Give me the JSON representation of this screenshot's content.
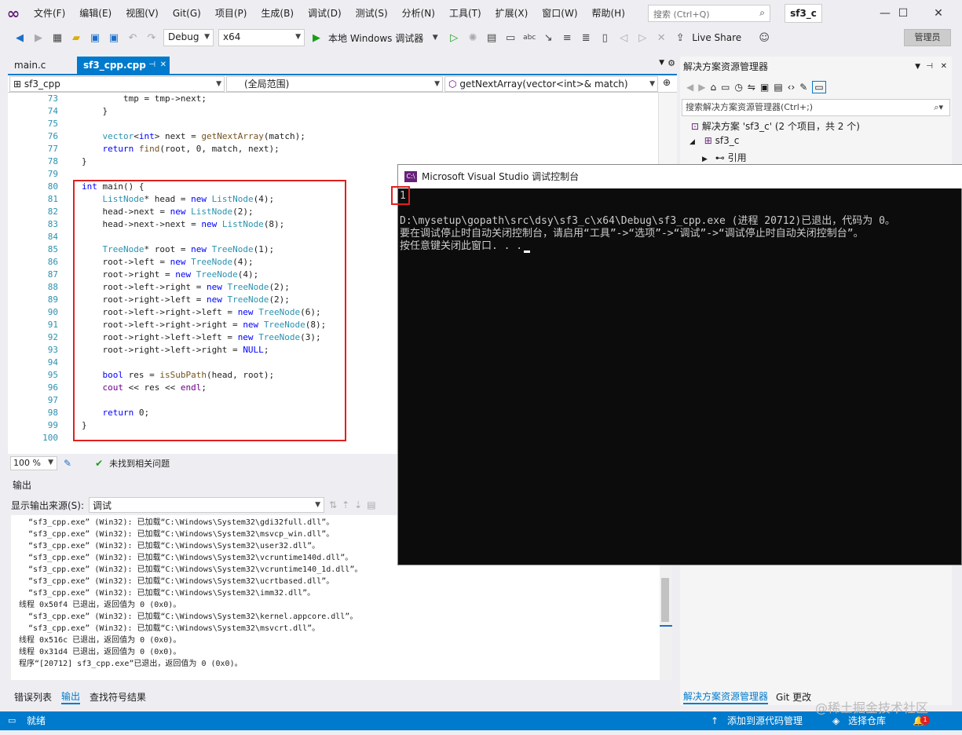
{
  "menu": {
    "items": [
      "文件(F)",
      "编辑(E)",
      "视图(V)",
      "Git(G)",
      "项目(P)",
      "生成(B)",
      "调试(D)",
      "测试(S)",
      "分析(N)",
      "工具(T)",
      "扩展(X)",
      "窗口(W)",
      "帮助(H)"
    ],
    "search_placeholder": "搜索 (Ctrl+Q)",
    "solution_name": "sf3_c"
  },
  "toolbar": {
    "config": "Debug",
    "platform": "x64",
    "run_label": "本地 Windows 调试器",
    "live_share": "Live Share",
    "admin": "管理员"
  },
  "tabs": [
    {
      "label": "main.c",
      "active": false
    },
    {
      "label": "sf3_cpp.cpp",
      "active": true
    }
  ],
  "navbar": {
    "project": "sf3_cpp",
    "scope": "(全局范围)",
    "member": "getNextArray(vector<int>& match)"
  },
  "code": {
    "lines": [
      {
        "n": "73",
        "text": "        tmp = tmp->next;"
      },
      {
        "n": "74",
        "text": "    }"
      },
      {
        "n": "75",
        "text": ""
      },
      {
        "n": "76",
        "text": "    vector<int> next = getNextArray(match);"
      },
      {
        "n": "77",
        "text": "    return find(root, 0, match, next);"
      },
      {
        "n": "78",
        "text": "}"
      },
      {
        "n": "79",
        "text": ""
      },
      {
        "n": "80",
        "text": "int main() {"
      },
      {
        "n": "81",
        "text": "    ListNode* head = new ListNode(4);"
      },
      {
        "n": "82",
        "text": "    head->next = new ListNode(2);"
      },
      {
        "n": "83",
        "text": "    head->next->next = new ListNode(8);"
      },
      {
        "n": "84",
        "text": ""
      },
      {
        "n": "85",
        "text": "    TreeNode* root = new TreeNode(1);"
      },
      {
        "n": "86",
        "text": "    root->left = new TreeNode(4);"
      },
      {
        "n": "87",
        "text": "    root->right = new TreeNode(4);"
      },
      {
        "n": "88",
        "text": "    root->left->right = new TreeNode(2);"
      },
      {
        "n": "89",
        "text": "    root->right->left = new TreeNode(2);"
      },
      {
        "n": "90",
        "text": "    root->left->right->left = new TreeNode(6);"
      },
      {
        "n": "91",
        "text": "    root->left->right->right = new TreeNode(8);"
      },
      {
        "n": "92",
        "text": "    root->right->left->left = new TreeNode(3);"
      },
      {
        "n": "93",
        "text": "    root->right->left->right = NULL;"
      },
      {
        "n": "94",
        "text": ""
      },
      {
        "n": "95",
        "text": "    bool res = isSubPath(head, root);"
      },
      {
        "n": "96",
        "text": "    cout << res << endl;"
      },
      {
        "n": "97",
        "text": ""
      },
      {
        "n": "98",
        "text": "    return 0;"
      },
      {
        "n": "99",
        "text": "}"
      },
      {
        "n": "100",
        "text": ""
      }
    ]
  },
  "editor_status": {
    "zoom": "100 %",
    "issues": "未找到相关问题"
  },
  "output": {
    "title": "输出",
    "source_label": "显示输出来源(S):",
    "source_value": "调试",
    "lines": [
      "  “sf3_cpp.exe” (Win32): 已加载“C:\\Windows\\System32\\gdi32full.dll”。",
      "  “sf3_cpp.exe” (Win32): 已加载“C:\\Windows\\System32\\msvcp_win.dll”。",
      "  “sf3_cpp.exe” (Win32): 已加载“C:\\Windows\\System32\\user32.dll”。",
      "  “sf3_cpp.exe” (Win32): 已加载“C:\\Windows\\System32\\vcruntime140d.dll”。",
      "  “sf3_cpp.exe” (Win32): 已加载“C:\\Windows\\System32\\vcruntime140_1d.dll”。",
      "  “sf3_cpp.exe” (Win32): 已加载“C:\\Windows\\System32\\ucrtbased.dll”。",
      "  “sf3_cpp.exe” (Win32): 已加载“C:\\Windows\\System32\\imm32.dll”。",
      "线程 0x50f4 已退出，返回值为 0 (0x0)。",
      "  “sf3_cpp.exe” (Win32): 已加载“C:\\Windows\\System32\\kernel.appcore.dll”。",
      "  “sf3_cpp.exe” (Win32): 已加载“C:\\Windows\\System32\\msvcrt.dll”。",
      "线程 0x516c 已退出，返回值为 0 (0x0)。",
      "线程 0x31d4 已退出，返回值为 0 (0x0)。",
      "程序“[20712] sf3_cpp.exe”已退出，返回值为 0 (0x0)。"
    ]
  },
  "bottom_tabs": [
    "错误列表",
    "输出",
    "查找符号结果"
  ],
  "solution_explorer": {
    "title": "解决方案资源管理器",
    "search_placeholder": "搜索解决方案资源管理器(Ctrl+;)",
    "tree": [
      {
        "label": "解决方案 'sf3_c' (2 个项目，共 2 个)"
      },
      {
        "label": "sf3_c"
      },
      {
        "label": "引用"
      }
    ],
    "bottom_tabs": [
      "解决方案资源管理器",
      "Git 更改"
    ]
  },
  "console": {
    "title": "Microsoft Visual Studio 调试控制台",
    "lines": [
      "1",
      "",
      "D:\\mysetup\\gopath\\src\\dsy\\sf3_c\\x64\\Debug\\sf3_cpp.exe (进程 20712)已退出，代码为 0。",
      "要在调试停止时自动关闭控制台，请启用“工具”->“选项”->“调试”->“调试停止时自动关闭控制台”。",
      "按任意键关闭此窗口. . ."
    ]
  },
  "statusbar": {
    "ready": "就绪",
    "add_source": "添加到源代码管理",
    "select_repo": "选择仓库",
    "notifications": "1"
  },
  "watermark": "@稀土掘金技术社区",
  "colors": {
    "accent": "#007acc",
    "highlight_box": "#e02020",
    "console_bg": "#0c0c0c"
  }
}
